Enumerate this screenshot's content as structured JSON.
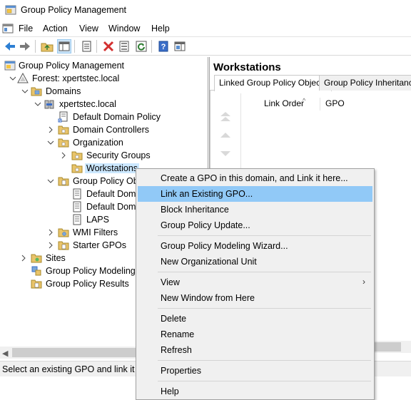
{
  "window": {
    "title": "Group Policy Management",
    "icon": "gpmc-app-icon"
  },
  "menubar": {
    "items": [
      "File",
      "Action",
      "View",
      "Window",
      "Help"
    ]
  },
  "toolbar": {
    "buttons": [
      "back-icon",
      "forward-icon",
      "up-folder-icon",
      "show-hide-console-tree-icon",
      "properties-icon",
      "delete-icon",
      "export-list-icon",
      "refresh-icon",
      "help-icon",
      "show-action-pane-icon"
    ]
  },
  "tree": {
    "root": "Group Policy Management",
    "forest": "Forest: xpertstec.local",
    "domains": "Domains",
    "domain": "xpertstec.local",
    "default_domain_policy": "Default Domain Policy",
    "domain_controllers": "Domain Controllers",
    "organization": "Organization",
    "security_groups": "Security Groups",
    "workstations": "Workstations",
    "group_policy_objects": "Group Policy Obj",
    "gpo_1": "Default Dom",
    "gpo_2": "Default Dom",
    "laps": "LAPS",
    "wmi_filters": "WMI Filters",
    "starter_gpos": "Starter GPOs",
    "sites": "Sites",
    "gp_modeling": "Group Policy Modeling",
    "gp_results": "Group Policy Results"
  },
  "right_pane": {
    "title": "Workstations",
    "tabs": [
      "Linked Group Policy Objects",
      "Group Policy Inheritance"
    ],
    "columns": [
      "Link Order",
      "GPO"
    ]
  },
  "context_menu": {
    "items": [
      "Create a GPO in this domain, and Link it here...",
      "Link an Existing GPO...",
      "Block Inheritance",
      "Group Policy Update...",
      "Group Policy Modeling Wizard...",
      "New Organizational Unit",
      "View",
      "New Window from Here",
      "Delete",
      "Rename",
      "Refresh",
      "Properties",
      "Help"
    ],
    "highlighted": "Link an Existing GPO..."
  },
  "status": {
    "text": "Select an existing GPO and link it to"
  },
  "colors": {
    "menu_highlight": "#91c9f7",
    "tree_selection": "#cce8ff",
    "menu_bg": "#f0f0f0"
  }
}
